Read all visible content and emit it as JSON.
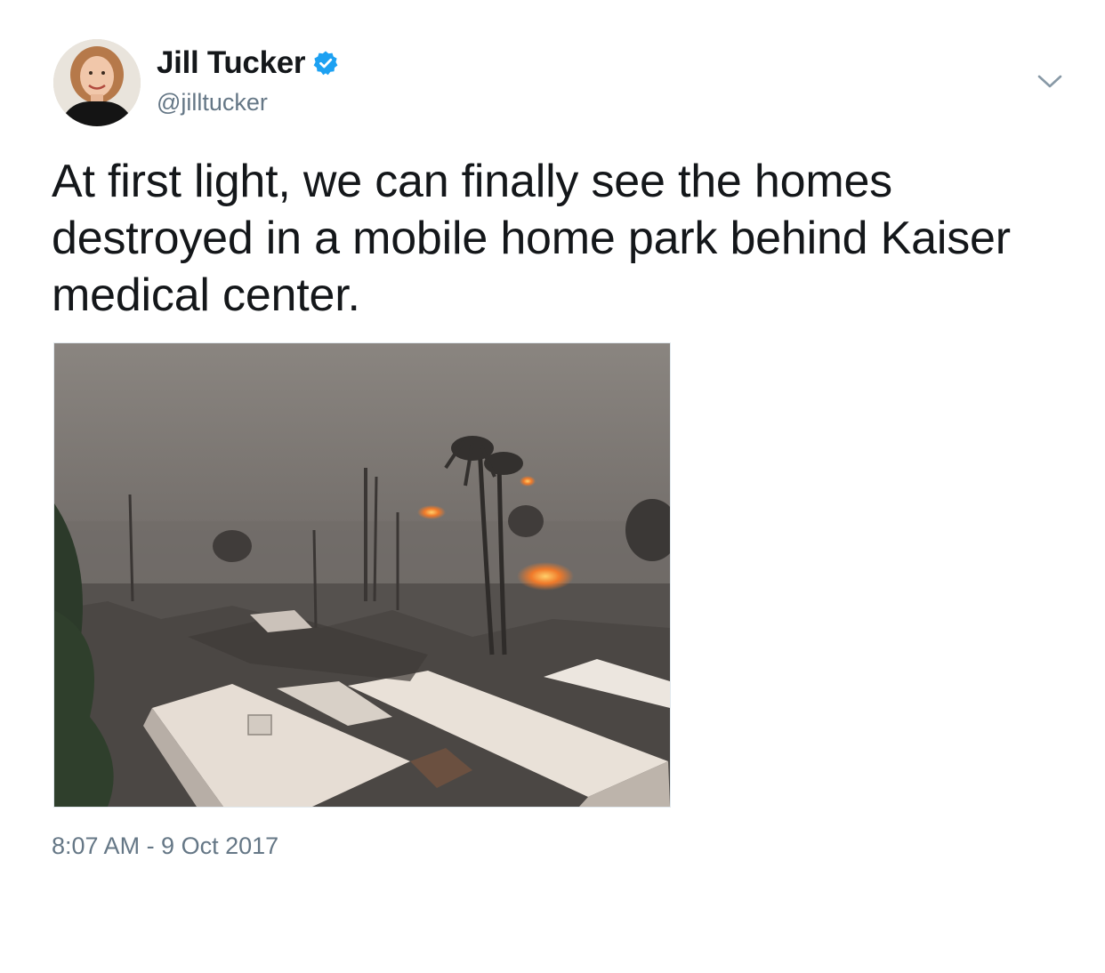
{
  "author": {
    "display_name": "Jill Tucker",
    "handle": "@jilltucker",
    "verified": true
  },
  "tweet": {
    "text": "At first light, we can finally see the homes destroyed in a mobile home park behind Kaiser medical center.",
    "timestamp": "8:07 AM - 9 Oct 2017"
  },
  "icons": {
    "verified": "verified-badge-icon",
    "menu": "chevron-down-icon"
  },
  "colors": {
    "text_primary": "#14171a",
    "text_secondary": "#657786",
    "verified_blue": "#1da1f2"
  }
}
